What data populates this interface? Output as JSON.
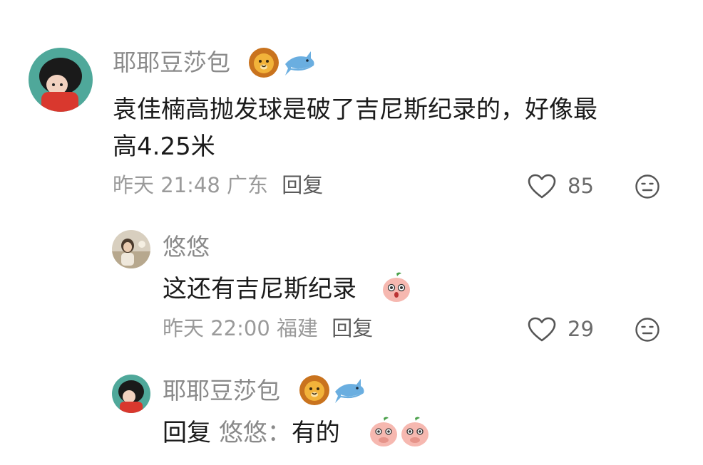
{
  "comments": [
    {
      "username": "耶耶豆莎包",
      "badge_icons": [
        "lion-face-icon",
        "shark-icon"
      ],
      "text_line1": "袁佳楠高抛发球是破了吉尼斯纪录的，好像最",
      "text_line2": "高4.25米",
      "meta_time": "昨天 21:48",
      "meta_location": "广东",
      "reply_label": "回复",
      "like_count": "85"
    },
    {
      "username": "悠悠",
      "text": "这还有吉尼斯纪录",
      "text_emoji": "peach-surprised-icon",
      "meta_time": "昨天 22:00",
      "meta_location": "福建",
      "reply_label": "回复",
      "like_count": "29"
    },
    {
      "username": "耶耶豆莎包",
      "badge_icons": [
        "lion-face-icon",
        "shark-icon"
      ],
      "reply_prefix": "回复",
      "reply_target": "悠悠：",
      "text": "有的",
      "text_emojis": [
        "peach-shy-icon",
        "peach-shy-icon"
      ]
    }
  ],
  "colors": {
    "username": "#8a8a8a",
    "text": "#1b1b1b",
    "meta": "#9a9a9a",
    "avatar_bg": "#4fa89a"
  }
}
